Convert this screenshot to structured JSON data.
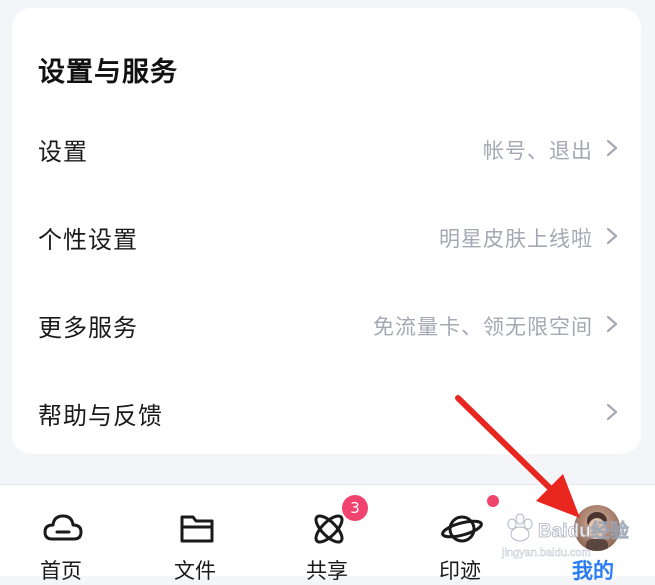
{
  "section": {
    "title": "设置与服务"
  },
  "rows": [
    {
      "label": "设置",
      "hint": "帐号、退出"
    },
    {
      "label": "个性设置",
      "hint": "明星皮肤上线啦"
    },
    {
      "label": "更多服务",
      "hint": "免流量卡、领无限空间"
    },
    {
      "label": "帮助与反馈",
      "hint": ""
    }
  ],
  "tabs": [
    {
      "label": "首页",
      "icon": "cloud-icon"
    },
    {
      "label": "文件",
      "icon": "folder-icon"
    },
    {
      "label": "共享",
      "icon": "atom-icon",
      "badge": "3"
    },
    {
      "label": "印迹",
      "icon": "planet-icon",
      "dot": true
    },
    {
      "label": "我的",
      "icon": "avatar",
      "active": true
    }
  ],
  "colors": {
    "accent": "#2a7cf6",
    "badge": "#f0436d",
    "hint": "#a3a8b3",
    "arrow": "#e8261f"
  },
  "watermark": {
    "logo": "Baidu经验",
    "url": "jingyan.baidu.com"
  }
}
